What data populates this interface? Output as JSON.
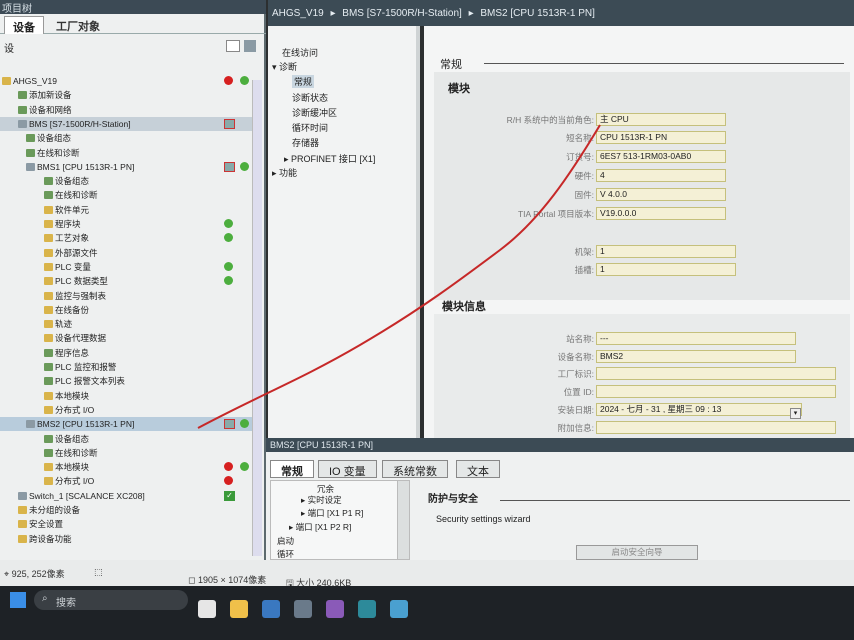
{
  "left_panel": {
    "title": "项目树",
    "tabs": [
      "设备",
      "工厂对象"
    ],
    "toolbar_label": "设"
  },
  "tree": [
    {
      "label": "AHGS_V19",
      "status": [
        "red",
        "green"
      ]
    },
    {
      "label": "添加新设备"
    },
    {
      "label": "设备和网络"
    },
    {
      "label": "BMS [S7-1500R/H-Station]",
      "status": [
        "mixed"
      ]
    },
    {
      "label": "设备组态"
    },
    {
      "label": "在线和诊断"
    },
    {
      "label": "BMS1 [CPU 1513R-1 PN]",
      "status": [
        "mixed",
        "green"
      ]
    },
    {
      "label": "设备组态"
    },
    {
      "label": "在线和诊断"
    },
    {
      "label": "软件单元"
    },
    {
      "label": "程序块",
      "status": [
        "green"
      ]
    },
    {
      "label": "工艺对象",
      "status": [
        "green"
      ]
    },
    {
      "label": "外部源文件"
    },
    {
      "label": "PLC 变量",
      "status": [
        "green"
      ]
    },
    {
      "label": "PLC 数据类型",
      "status": [
        "green"
      ]
    },
    {
      "label": "监控与强制表"
    },
    {
      "label": "在线备份"
    },
    {
      "label": "轨迹"
    },
    {
      "label": "设备代理数据"
    },
    {
      "label": "程序信息"
    },
    {
      "label": "PLC 监控和报警"
    },
    {
      "label": "PLC 报警文本列表"
    },
    {
      "label": "本地模块"
    },
    {
      "label": "分布式 I/O"
    },
    {
      "label": "BMS2 [CPU 1513R-1 PN]",
      "status": [
        "mixed",
        "green"
      ]
    },
    {
      "label": "设备组态"
    },
    {
      "label": "在线和诊断"
    },
    {
      "label": "本地模块",
      "status": [
        "red",
        "green"
      ]
    },
    {
      "label": "分布式 I/O",
      "status": [
        "red"
      ]
    },
    {
      "label": "Switch_1 [SCALANCE XC208]",
      "status": [
        "check"
      ]
    },
    {
      "label": "未分组的设备"
    },
    {
      "label": "安全设置"
    },
    {
      "label": "跨设备功能"
    }
  ],
  "header": {
    "breadcrumb": [
      "AHGS_V19",
      "BMS [S7-1500R/H-Station]",
      "BMS2 [CPU 1513R-1 PN]"
    ]
  },
  "nav": {
    "items": [
      "在线访问",
      "诊断",
      "常规",
      "诊断状态",
      "诊断缓冲区",
      "循环时间",
      "存储器",
      "PROFINET 接口 [X1]",
      "功能"
    ]
  },
  "content": {
    "section_general": "常规",
    "section_module": "模块",
    "fields": [
      {
        "label": "R/H 系统中的当前角色:",
        "value": "主 CPU"
      },
      {
        "label": "短名称:",
        "value": "CPU 1513R-1 PN"
      },
      {
        "label": "订货号:",
        "value": "6ES7 513-1RM03-0AB0"
      },
      {
        "label": "硬件:",
        "value": "4"
      },
      {
        "label": "固件:",
        "value": "V 4.0.0"
      },
      {
        "label": "TIA Portal 项目版本:",
        "value": "V19.0.0.0"
      }
    ],
    "rack_fields": [
      {
        "label": "机架:",
        "value": "1"
      },
      {
        "label": "插槽:",
        "value": "1"
      }
    ],
    "section_info": "模块信息",
    "info_fields": [
      {
        "label": "站名称:",
        "value": "---"
      },
      {
        "label": "设备名称:",
        "value": "BMS2"
      },
      {
        "label": "工厂标识:",
        "value": ""
      },
      {
        "label": "位置 ID:",
        "value": ""
      },
      {
        "label": "安装日期:",
        "value": "2024 - 七月 - 31 , 星期三    09 : 13"
      },
      {
        "label": "附加信息:",
        "value": ""
      }
    ]
  },
  "inspector": {
    "title": "BMS2 [CPU 1513R-1 PN]",
    "tabs": [
      "常规",
      "IO 变量",
      "系统常数",
      "文本"
    ],
    "tree_items": [
      "冗余",
      "实时设定",
      "端口 [X1 P1 R]",
      "端口 [X1 P2 R]",
      "启动",
      "循环"
    ],
    "section": "防护与安全",
    "wizard_label": "Security settings wizard",
    "wizard_button": "启动安全向导"
  },
  "status_bar": {
    "coords": "925, 252像素",
    "dimensions": "1905 × 1074像素",
    "size": "大小 240.6KB"
  },
  "taskbar": {
    "search": "搜索"
  },
  "colors": {
    "header_bg": "#3c4b55",
    "status_green": "#4cae3e",
    "status_red": "#d62020",
    "annotation_red": "#c62828"
  }
}
